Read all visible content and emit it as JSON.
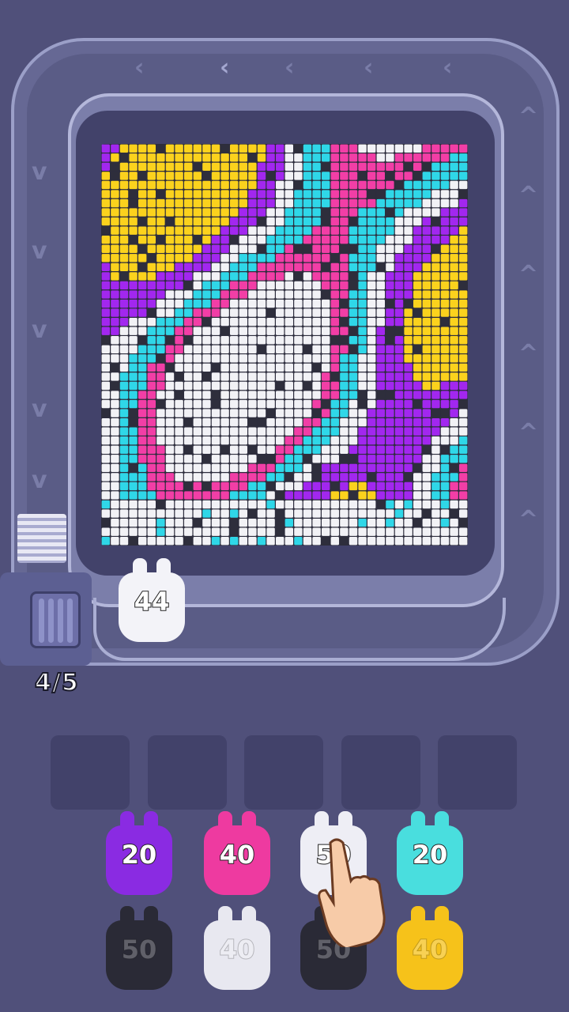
{
  "game": {
    "progress_counter": "4/5",
    "active_shooter": {
      "value": "44",
      "color": "#f3f3f8"
    },
    "empty_slots": 5,
    "board_palette": [
      "#2e2e3c",
      "#f2f2f6",
      "#fbd21d",
      "#a227ef",
      "#f23ea6",
      "#2fd7e8"
    ],
    "shooter_rows": [
      [
        {
          "value": "20",
          "color": "#8a2be2",
          "dim": false
        },
        {
          "value": "40",
          "color": "#ee3aa0",
          "dim": false
        },
        {
          "value": "50",
          "color": "#eeeef5",
          "dim": false
        },
        {
          "value": "20",
          "color": "#49dede",
          "dim": false
        }
      ],
      [
        {
          "value": "50",
          "color": "#2a2a36",
          "dim": true
        },
        {
          "value": "40",
          "color": "#e8e8f0",
          "dim": true
        },
        {
          "value": "50",
          "color": "#2a2a36",
          "dim": true
        },
        {
          "value": "40",
          "color": "#f6c21a",
          "dim": true
        }
      ]
    ],
    "icons": {
      "pointer": "pointing-hand-icon",
      "conveyor": "chevron-left-icon"
    }
  }
}
